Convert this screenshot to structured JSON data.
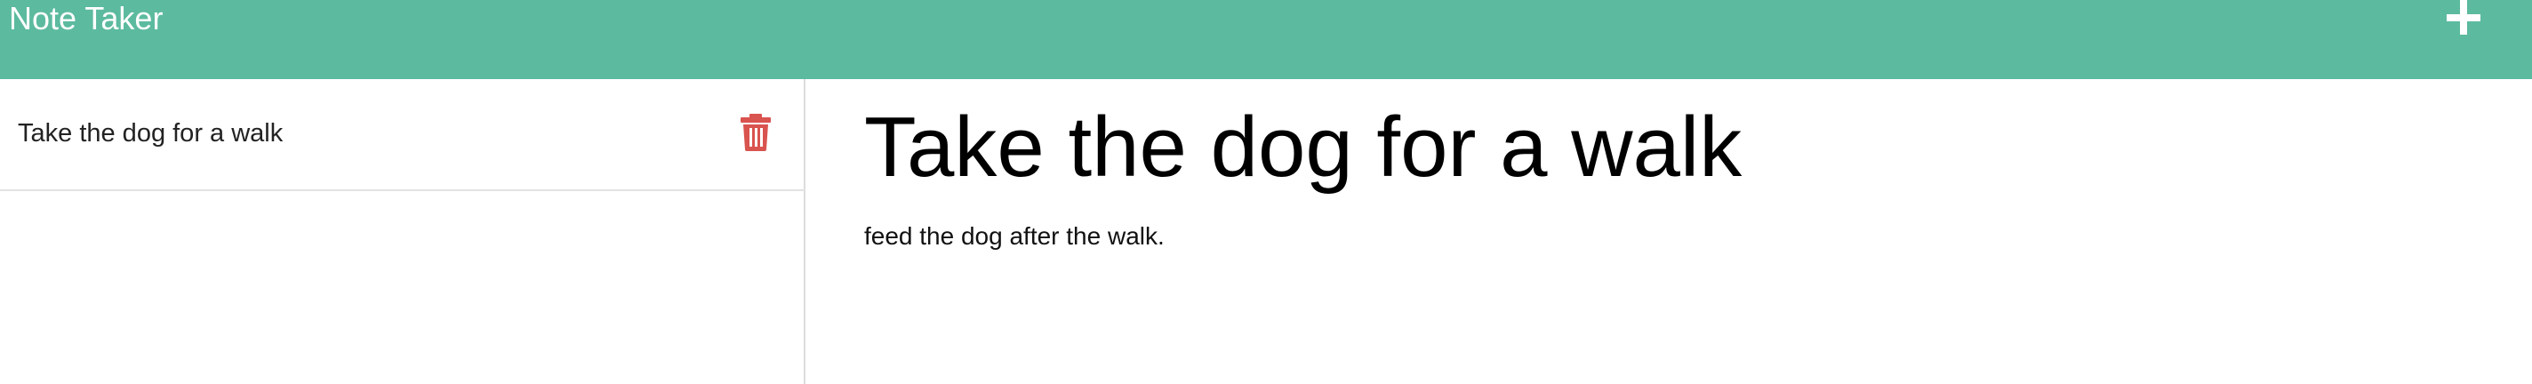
{
  "app": {
    "title": "Note Taker",
    "accent_color": "#5cba9f"
  },
  "toolbar": {
    "new_note_icon": "plus-icon"
  },
  "sidebar": {
    "notes": [
      {
        "title": "Take the dog for a walk",
        "delete_icon": "trash-icon",
        "delete_color": "#d9534f"
      }
    ]
  },
  "editor": {
    "title": "Take the dog for a walk",
    "text": "feed the dog after the walk."
  }
}
